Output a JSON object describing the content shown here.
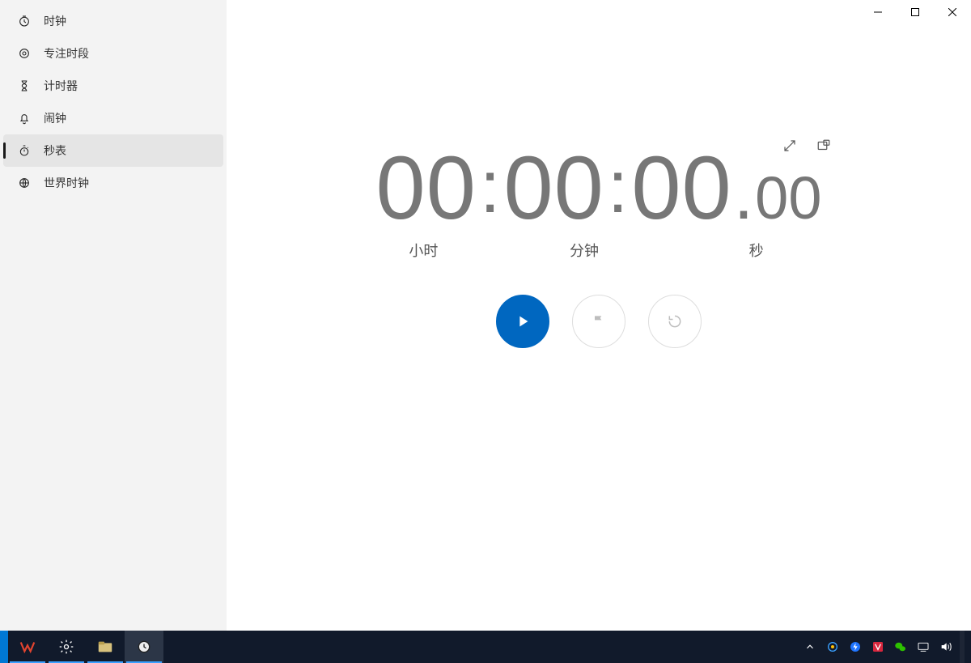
{
  "window": {
    "title": "时钟",
    "controls": {
      "minimize": "–",
      "maximize": "▢",
      "close": "✕"
    }
  },
  "sidebar": {
    "items": [
      {
        "id": "focus",
        "label": "专注时段",
        "icon": "target-icon",
        "selected": false
      },
      {
        "id": "timer",
        "label": "计时器",
        "icon": "hourglass-icon",
        "selected": false
      },
      {
        "id": "alarm",
        "label": "闹钟",
        "icon": "bell-icon",
        "selected": false
      },
      {
        "id": "stopwatch",
        "label": "秒表",
        "icon": "stopwatch-icon",
        "selected": true
      },
      {
        "id": "worldclock",
        "label": "世界时钟",
        "icon": "globe-icon",
        "selected": false
      }
    ]
  },
  "stopwatch": {
    "hours": "00",
    "minutes": "00",
    "seconds": "00",
    "centiseconds": "00",
    "labels": {
      "hours": "小时",
      "minutes": "分钟",
      "seconds": "秒"
    },
    "corner_actions": {
      "expand": "expand-icon",
      "pin": "compact-overlay-icon"
    },
    "controls": {
      "play": {
        "icon": "play-icon",
        "enabled": true,
        "primary": true
      },
      "flag": {
        "icon": "flag-icon",
        "enabled": false,
        "primary": false
      },
      "reset": {
        "icon": "reset-icon",
        "enabled": false,
        "primary": false
      }
    }
  },
  "taskbar": {
    "left": [
      {
        "id": "start",
        "icon": "start-icon",
        "running": false,
        "active": false,
        "color": "#00a2ed"
      },
      {
        "id": "wps",
        "icon": "wps-icon",
        "running": true,
        "active": false,
        "color": "#e2442f"
      },
      {
        "id": "settings",
        "icon": "gear-icon",
        "running": true,
        "active": false,
        "color": "#ffffff"
      },
      {
        "id": "explorer",
        "icon": "explorer-icon",
        "running": true,
        "active": false,
        "color": "#d8c27d"
      },
      {
        "id": "clock",
        "icon": "clock-icon",
        "running": true,
        "active": true,
        "color": "#ffffff"
      }
    ],
    "tray": [
      {
        "id": "chevron",
        "icon": "chevron-up-icon",
        "color": "#ffffff"
      },
      {
        "id": "manager",
        "icon": "manager-icon",
        "color": "#3aa0ff"
      },
      {
        "id": "flash",
        "icon": "flash-icon",
        "color": "#1e74ff"
      },
      {
        "id": "antivirus",
        "icon": "v-icon",
        "color": "#d7263d"
      },
      {
        "id": "wechat",
        "icon": "wechat-icon",
        "color": "#2dc100"
      },
      {
        "id": "input",
        "icon": "ime-icon",
        "color": "#ffffff"
      },
      {
        "id": "volume",
        "icon": "volume-icon",
        "color": "#ffffff"
      }
    ]
  }
}
